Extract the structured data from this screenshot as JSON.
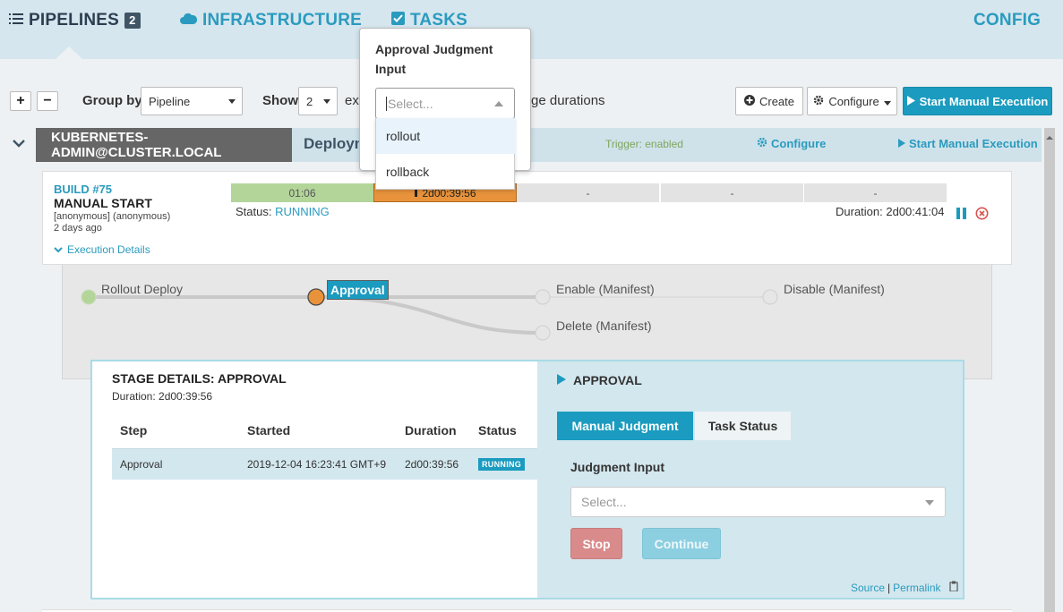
{
  "nav": {
    "pipelines_label": "PIPELINES",
    "pipelines_count": "2",
    "infrastructure_label": "INFRASTRUCTURE",
    "tasks_label": "TASKS",
    "config_label": "CONFIG"
  },
  "toolbar": {
    "expand_label": "+",
    "collapse_label": "−",
    "group_by_label": "Group by",
    "group_by_value": "Pipeline",
    "show_label": "Show",
    "show_value": "2",
    "exec_text_partial": "exe",
    "durations_text": "ge durations",
    "create_label": "Create",
    "configure_label": "Configure",
    "start_manual_label": "Start Manual Execution"
  },
  "pipeline": {
    "account": "KUBERNETES-ADMIN@CLUSTER.LOCAL",
    "name_partial": "Deploym",
    "trigger": "Trigger: enabled",
    "configure_label": "Configure",
    "start_label": "Start Manual Execution"
  },
  "execution": {
    "build": "BUILD #75",
    "trigger_type": "MANUAL START",
    "user": "[anonymous] (anonymous)",
    "age": "2 days ago",
    "details_label": "Execution Details",
    "segments": [
      "01:06",
      "2d00:39:56",
      "-",
      "-",
      "-"
    ],
    "status_label": "Status:",
    "status_value": "RUNNING",
    "duration_label": "Duration: 2d00:41:04"
  },
  "graph": {
    "nodes": [
      "Rollout Deploy",
      "Approval",
      "Enable (Manifest)",
      "Disable (Manifest)",
      "Delete (Manifest)"
    ]
  },
  "stage": {
    "title": "STAGE DETAILS: APPROVAL",
    "duration": "Duration: 2d00:39:56",
    "columns": [
      "Step",
      "Started",
      "Duration",
      "Status"
    ],
    "rows": [
      {
        "step": "Approval",
        "started": "2019-12-04 16:23:41 GMT+9",
        "duration": "2d00:39:56",
        "status": "RUNNING"
      }
    ],
    "panel_title": "APPROVAL",
    "tabs": [
      "Manual Judgment",
      "Task Status"
    ],
    "judgment_label": "Judgment Input",
    "judgment_placeholder": "Select...",
    "stop_label": "Stop",
    "continue_label": "Continue",
    "source_label": "Source",
    "permalink_label": "Permalink"
  },
  "popover": {
    "title": "Approval Judgment Input",
    "placeholder": "Select...",
    "options": [
      "rollout",
      "rollback"
    ]
  },
  "colors": {
    "accent": "#1a9bbf",
    "nav_bg": "#d6e6ee",
    "success_segment": "#b3d59a",
    "running_segment": "#e8933b",
    "stop": "#d98b8b"
  }
}
